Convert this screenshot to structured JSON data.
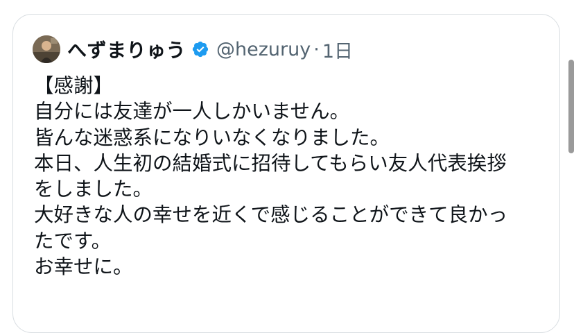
{
  "tweet": {
    "display_name": "へずまりゅう",
    "handle": "@hezuruy",
    "separator": "·",
    "timestamp": "1日",
    "avatar_icon": "user-avatar-photo",
    "verified_icon": "verified-badge-icon",
    "lines": [
      "【感謝】",
      "自分には友達が一人しかいません。",
      "皆んな迷惑系になりいなくなりました。",
      "本日、人生初の結婚式に招待してもらい友人代表挨拶",
      "をしました。",
      "大好きな人の幸せを近くで感じることができて良かっ",
      "たです。",
      "お幸せに。"
    ]
  },
  "colors": {
    "text": "#0f1419",
    "secondary": "#536471",
    "verified": "#1d9bf0",
    "border": "#d8dde1"
  }
}
